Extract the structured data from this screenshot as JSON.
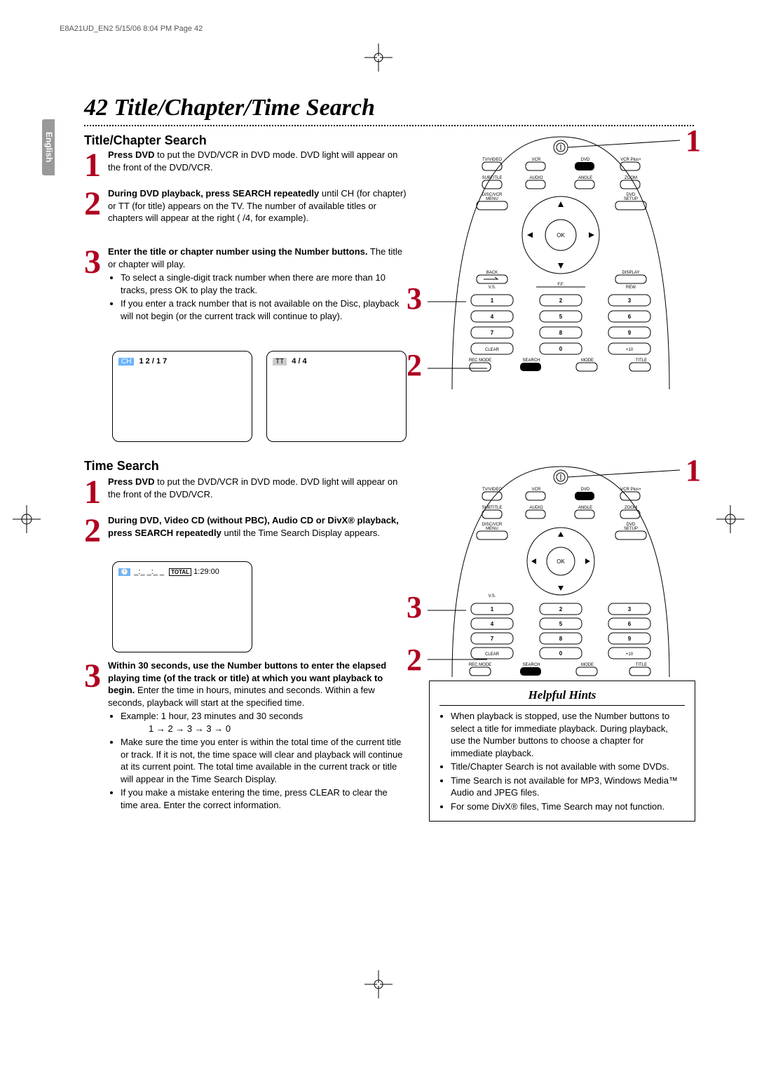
{
  "header_line": "E8A21UD_EN2  5/15/06  8:04 PM  Page 42",
  "side_tab": "English",
  "page_number": "42",
  "page_title": "Title/Chapter/Time Search",
  "section1_heading": "Title/Chapter Search",
  "section2_heading": "Time Search",
  "hints_title": "Helpful Hints",
  "s1": {
    "step1_bold": "Press DVD",
    "step1_rest": " to put the DVD/VCR in DVD mode. DVD light will appear on the front of the DVD/VCR.",
    "step2_bold": "During DVD playback, press SEARCH repeatedly",
    "step2_rest": " until CH (for chapter) or TT (for title) appears on the TV. The number of available titles or chapters will appear at the right (   /4, for example).",
    "step3_bold": "Enter the title or chapter number using the Number buttons.",
    "step3_rest": " The title or chapter will play.",
    "step3_bullets": [
      "To select a single-digit track number when there are more than 10 tracks, press OK to play the track.",
      "If you enter a track number that is not available on the Disc, playback will not begin (or the current track will continue to play)."
    ],
    "display_ch_label": "CH",
    "display_ch_value": " 1 2 / 1 7",
    "display_tt_label": "TT",
    "display_tt_value": " 4 / 4"
  },
  "s2": {
    "step1_bold": "Press DVD",
    "step1_rest": " to put the DVD/VCR in DVD mode. DVD light will appear on the front of the DVD/VCR.",
    "step2_bold": "During DVD, Video CD (without PBC), Audio CD or DivX® playback, press SEARCH repeatedly",
    "step2_rest": " until the Time Search Display appears.",
    "time_display_clock": "🕐",
    "time_display_mask": "_:_ _:_ _",
    "time_display_total": "TOTAL",
    "time_display_value": " 1:29:00",
    "step3_bold": "Within 30 seconds, use the Number buttons to enter the elapsed playing time (of the track or title) at which you want playback to begin.",
    "step3_rest": " Enter the time in hours, minutes and seconds. Within a few seconds, playback will start at the specified time.",
    "step3_bullets": [
      "Example: 1 hour, 23 minutes and 30 seconds",
      "Make sure the time you enter is within the total time of the current title or track. If it is not, the time space will clear and playback will continue at its current point. The total time available in the current track or title will appear in the Time Search Display.",
      "If you make a mistake entering the time, press CLEAR to clear the time area. Enter the correct information."
    ],
    "example_sequence": "1 → 2 → 3 → 3 → 0"
  },
  "hints": [
    "When playback is stopped, use the Number buttons to select a title for immediate playback. During playback, use the Number buttons to choose a chapter for immediate playback.",
    "Title/Chapter Search is not available with some DVDs.",
    "Time Search is not available for MP3, Windows Media™ Audio and JPEG files.",
    "For some DivX® files, Time Search may not function."
  ],
  "remote_labels": {
    "tv_video": "TV/VIDEO",
    "vcr": "VCR",
    "dvd": "DVD",
    "vcr_plus": "VCR Plus+",
    "subtitle": "SUBTITLE",
    "audio": "AUDIO",
    "angle": "ANGLE",
    "zoom": "ZOOM",
    "menu": "DISC/VCR MENU",
    "setup": "DVD SETUP",
    "ok": "OK",
    "back": "BACK",
    "display": "DISPLAY",
    "clear": "CLEAR",
    "rec_mode": "REC MODE",
    "search": "SEARCH",
    "mode": "MODE",
    "title": "TITLE",
    "plus10": "+10",
    "vs": "V.S.",
    "rew": "REW",
    "ff": "F.F."
  },
  "nums": {
    "n1": "1",
    "n2": "2",
    "n3": "3"
  }
}
